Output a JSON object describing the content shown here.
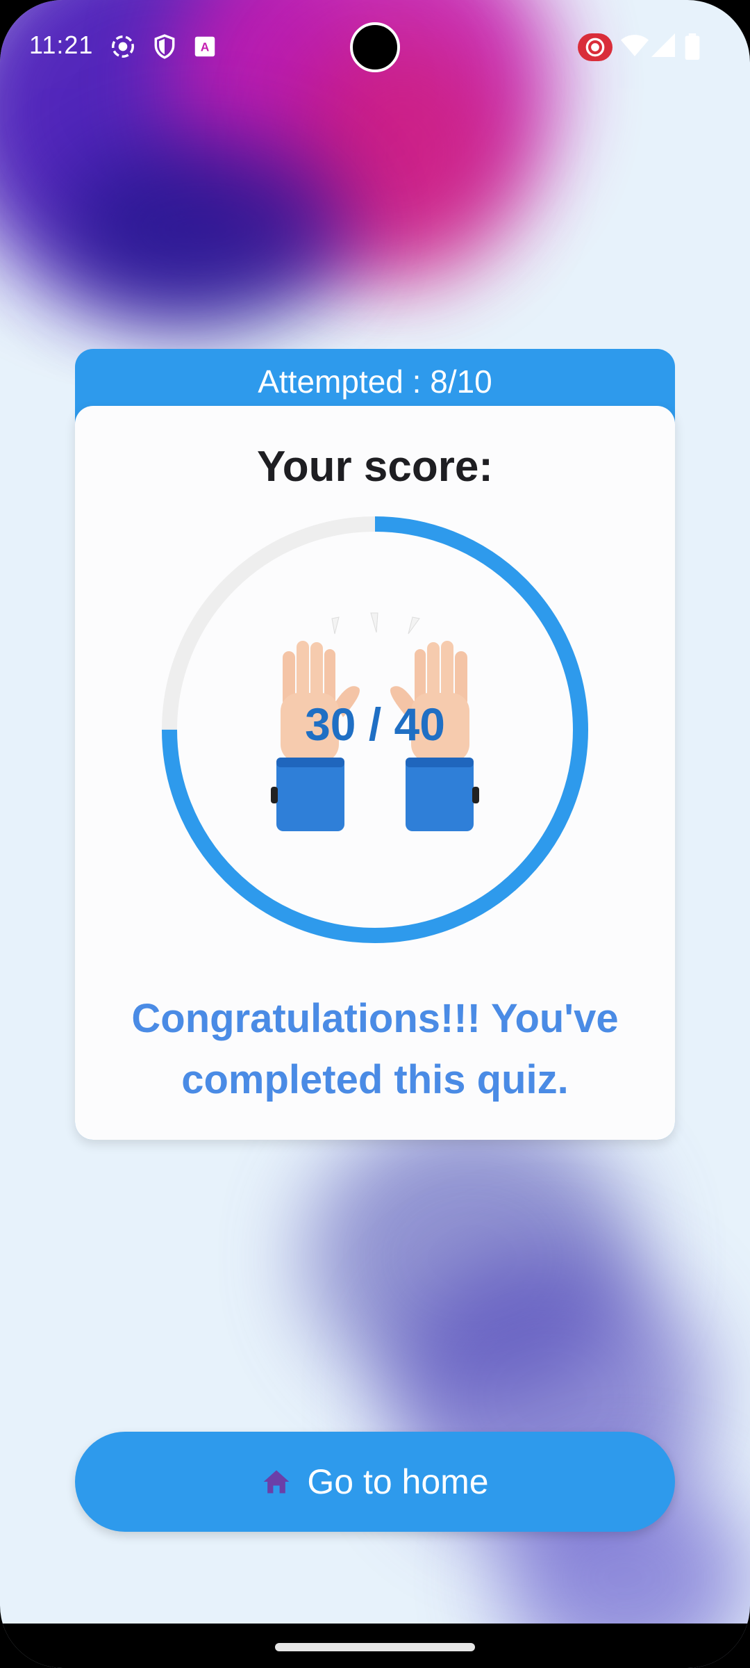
{
  "status_bar": {
    "time": "11:21"
  },
  "card": {
    "header": "Attempted : 8/10",
    "title": "Your score:",
    "score_text": "30 / 40",
    "score_fraction": 0.75,
    "message": "Congratulations!!! You've completed this quiz."
  },
  "home_button": {
    "label": "Go to home"
  },
  "colors": {
    "accent": "#2e9aec",
    "score_text": "#1f6fc4",
    "message": "#4a8be5",
    "ring_track": "#eeeeee"
  }
}
